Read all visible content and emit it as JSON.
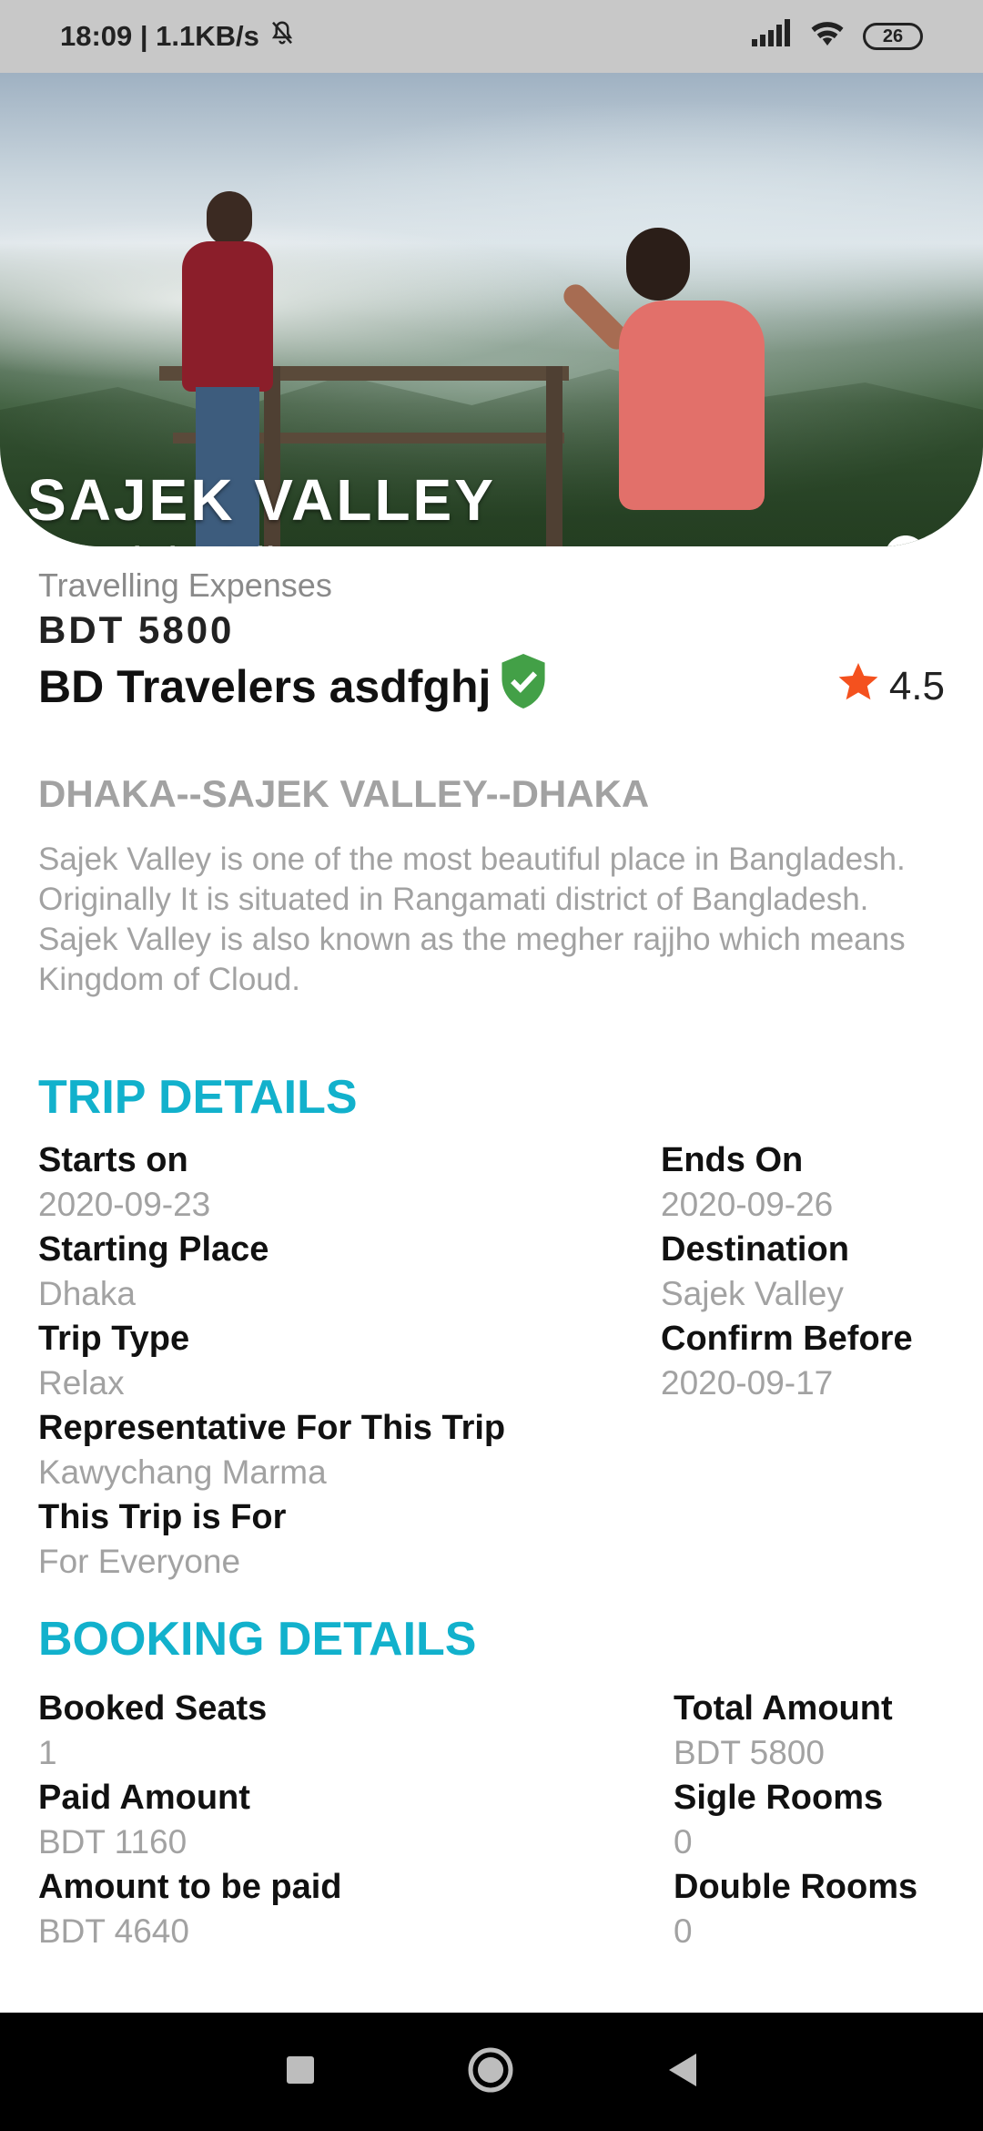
{
  "status_bar": {
    "time_speed": "18:09 | 1.1KB/s",
    "battery": "26",
    "icons": [
      "bell-off-icon",
      "signal-icon",
      "wifi-icon",
      "battery-icon"
    ]
  },
  "hero": {
    "title": "SAJEK VALLEY",
    "location": "Sajek Valley",
    "icons": [
      "navigation-arrow-icon",
      "map-pin-icon"
    ]
  },
  "summary": {
    "expenses_label": "Travelling Expenses",
    "price": "BDT 5800",
    "agency": "BD Travelers asdfghj",
    "verified_icon": "verified-shield-icon",
    "rating": "4.5",
    "rating_icon": "star-icon",
    "route": "DHAKA--SAJEK VALLEY--DHAKA",
    "description": "Sajek Valley is one of the most beautiful place in Bangladesh. Originally It is situated in Rangamati district of Bangladesh. Sajek Valley is also known as the megher rajjho which means Kingdom of Cloud."
  },
  "trip_details": {
    "title": "TRIP DETAILS",
    "left": [
      {
        "label": "Starts on",
        "value": "2020-09-23"
      },
      {
        "label": "Starting Place",
        "value": "Dhaka"
      },
      {
        "label": "Trip Type",
        "value": "Relax"
      },
      {
        "label": "Representative For This Trip",
        "value": "Kawychang Marma"
      },
      {
        "label": "This Trip is For",
        "value": "For Everyone"
      }
    ],
    "right": [
      {
        "label": "Ends On",
        "value": "2020-09-26"
      },
      {
        "label": "Destination",
        "value": "Sajek Valley"
      },
      {
        "label": "Confirm Before",
        "value": "2020-09-17"
      }
    ]
  },
  "booking_details": {
    "title": "BOOKING DETAILS",
    "left": [
      {
        "label": "Booked Seats",
        "value": "1"
      },
      {
        "label": "Paid Amount",
        "value": "BDT 1160"
      },
      {
        "label": "Amount to be paid",
        "value": "BDT 4640"
      }
    ],
    "right": [
      {
        "label": "Total Amount",
        "value": "BDT 5800"
      },
      {
        "label": "Sigle Rooms",
        "value": "0"
      },
      {
        "label": "Double Rooms",
        "value": "0"
      }
    ]
  },
  "colors": {
    "accent": "#12b1cc",
    "muted": "#a2a2a2",
    "verified": "#43a047",
    "star": "#f4511e"
  },
  "nav_bar": {
    "icons": [
      "recents-square-icon",
      "home-circle-icon",
      "back-triangle-icon"
    ]
  }
}
